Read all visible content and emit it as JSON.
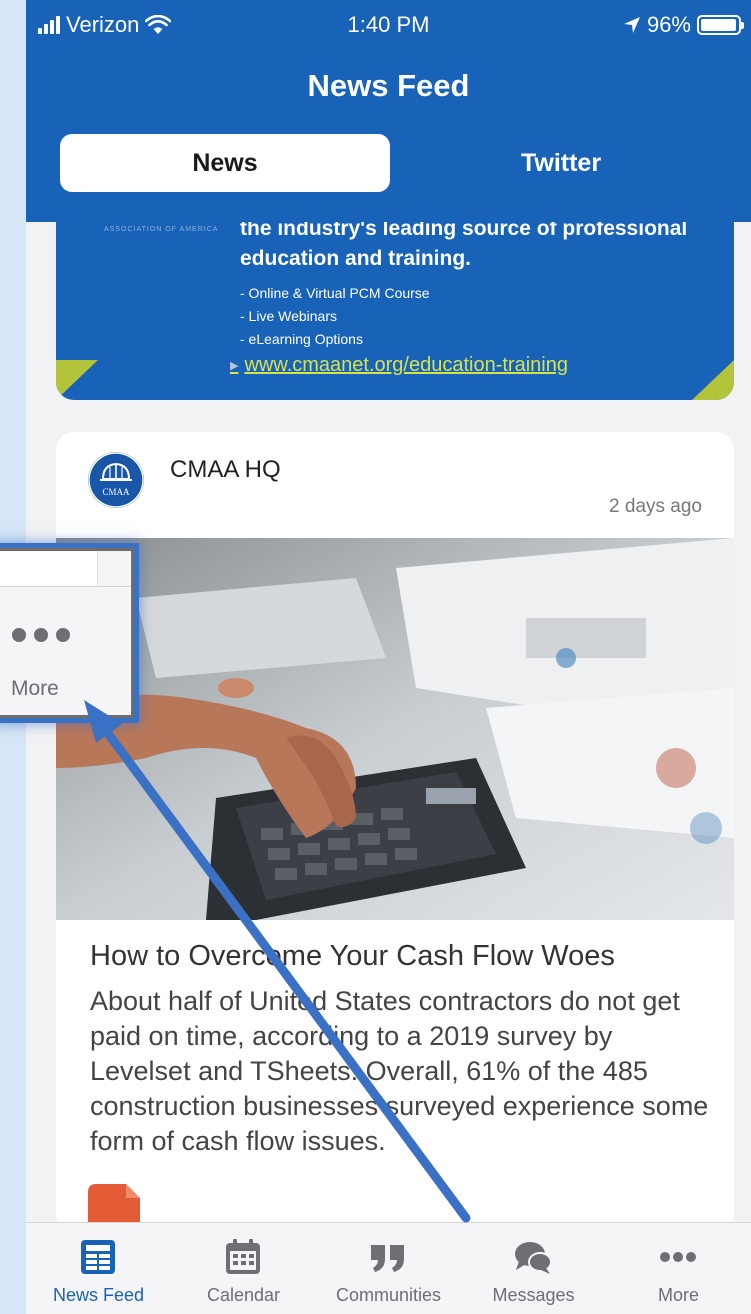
{
  "status_bar": {
    "carrier": "Verizon",
    "time": "1:40 PM",
    "battery": "96%",
    "icons": [
      "signal-icon",
      "wifi-icon",
      "location-icon",
      "battery-icon"
    ]
  },
  "header": {
    "title": "News Feed",
    "tabs": [
      {
        "label": "News",
        "active": true
      },
      {
        "label": "Twitter",
        "active": false
      }
    ]
  },
  "banner": {
    "faint_text": "ASSOCIATION OF AMERICA",
    "headline": "the industry's leading source of professional education and training.",
    "items": [
      "- Online & Virtual PCM Course",
      "- Live Webinars",
      "- eLearning Options"
    ],
    "link": "www.cmaanet.org/education-training"
  },
  "post": {
    "author": "CMAA HQ",
    "avatar_text": "CMAA",
    "time": "2 days ago",
    "title": "How to Overcome Your Cash Flow Woes",
    "body": "About half of United States contractors do not get paid on time, according to a 2019 survey by Levelset and TSheets. Overall, 61% of the 485 construction businesses surveyed experience some form of cash flow issues."
  },
  "tabbar": {
    "items": [
      {
        "label": "News Feed",
        "icon": "news-feed-icon",
        "active": true
      },
      {
        "label": "Calendar",
        "icon": "calendar-icon",
        "active": false
      },
      {
        "label": "Communities",
        "icon": "quote-icon",
        "active": false
      },
      {
        "label": "Messages",
        "icon": "chat-bubble-icon",
        "active": false
      },
      {
        "label": "More",
        "icon": "more-dots-icon",
        "active": false
      }
    ]
  },
  "callout": {
    "label": "More",
    "icon": "more-dots-icon"
  },
  "colors": {
    "brand_blue": "#1862b8",
    "accent_lime": "#d8e24a",
    "tab_inactive": "#6e6e73",
    "annotation_arrow": "#3b71c5"
  }
}
